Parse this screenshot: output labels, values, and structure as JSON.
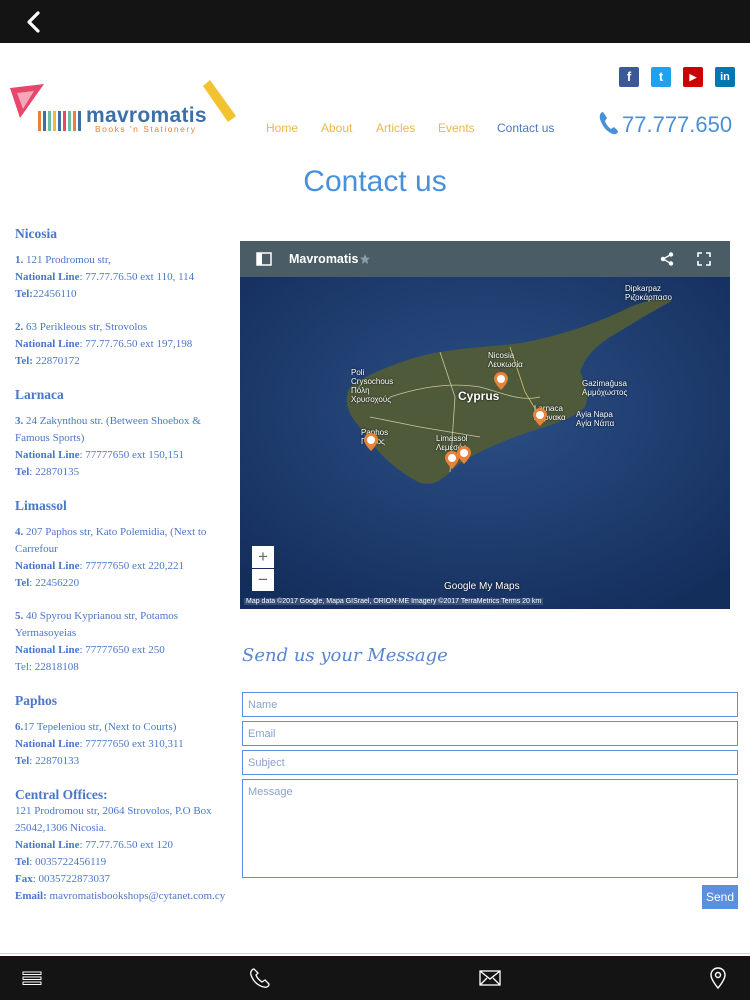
{
  "brand": {
    "name": "mavromatis",
    "tagline": "Books 'n Stationery"
  },
  "nav": [
    {
      "label": "Home"
    },
    {
      "label": "About"
    },
    {
      "label": "Articles"
    },
    {
      "label": "Events"
    },
    {
      "label": "Contact us"
    }
  ],
  "phone": "77.777.650",
  "social": [
    {
      "icon": "facebook-icon",
      "glyph": "f",
      "color": "#3b5998"
    },
    {
      "icon": "twitter-icon",
      "glyph": "t",
      "color": "#1da1f2"
    },
    {
      "icon": "youtube-icon",
      "glyph": "▶",
      "color": "#cc0000"
    },
    {
      "icon": "linkedin-icon",
      "glyph": "in",
      "color": "#0077b5"
    }
  ],
  "page_title": "Contact us",
  "locations": {
    "nicosia": {
      "title": "Nicosia",
      "a1": {
        "num": "1.",
        "line1": " 121 Prodromou str,",
        "nl_label": "National Line",
        "nl_value": ": 77.77.76.50 ext 110, 114",
        "tel_label": "Tel:",
        "tel_value": "22456110"
      },
      "a2": {
        "num": "2.",
        "line1": " 63 Perikleous str, Strovolos",
        "nl_label": "National Line",
        "nl_value": ": 77.77.76.50 ext 197,198",
        "tel_label": "Tel:",
        "tel_value": " 22870172"
      }
    },
    "larnaca": {
      "title": "Larnaca",
      "a3": {
        "num": "3.",
        "line1": " 24 Zakynthou str. (Between Shoebox & Famous Sports)",
        "nl_label": "National Line",
        "nl_value": ": 77777650 ext 150,151",
        "tel_label": "Tel",
        "tel_value": ": 22870135"
      }
    },
    "limassol": {
      "title": "Limassol",
      "a4": {
        "num": "4.",
        "line1": " 207 Paphos str, Kato Polemidia, (Next to Carrefour",
        "nl_label": "National Line",
        "nl_value": ": 77777650 ext 220,221",
        "tel_label": "Tel",
        "tel_value": ": 22456220"
      },
      "a5": {
        "num": "5.",
        "line1": " 40 Spyrou Kyprianou str, Potamos Yermasoyeias",
        "nl_label": "National Line",
        "nl_value": ": 77777650 ext 250",
        "tel_value": "Tel: 22818108"
      }
    },
    "paphos": {
      "title": "Paphos",
      "a6": {
        "num": "6.",
        "line1": "17 Tepeleniou str, (Next to Courts)",
        "nl_label": "National Line",
        "nl_value": ": 77777650 ext 310,311",
        "tel_label": "Tel",
        "tel_value": ": 22870133"
      }
    },
    "central": {
      "title": "Central Offices:",
      "line1": "121 Prodromou str, 2064 Strovolos, P.O Box 25042,1306 Nicosia.",
      "nl_label": "National Line",
      "nl_value": ": 77.77.76.50 ext 120",
      "tel_label": "Tel",
      "tel_value": ": 0035722456119",
      "fax_label": "Fax",
      "fax_value": ": 0035722873037",
      "email_label": "Email:",
      "email_value": " mavromatisbookshops@cytanet.com.cy"
    }
  },
  "map": {
    "title": "Mavromatis",
    "labels": {
      "nicosia": "Nicosia\nΛευκωσία",
      "cyprus": "Cyprus",
      "polis": "Poli\nCrysochous\nΠόλη\nΧρυσοχούς",
      "paphos": "Paphos\nΠάφος",
      "limassol": "Limassol\nΛεμεσός",
      "larnaca": "Larnaca\nΛάρνακα",
      "gazimagusa": "Gazimağusa\nΑμμόχωστος",
      "ayianapa": "Ayia Napa\nΑγία Νάπα",
      "dipkarpaz": "Dipkarpaz\nΡιζοκάρπασο"
    },
    "zoom_in": "+",
    "zoom_out": "−",
    "attribution": "Map data ©2017 Google, Mapa GISrael, ORION-ME Imagery ©2017 TerraMetrics   Terms   20 km",
    "provider": "Google My Maps"
  },
  "form": {
    "title": "Send us your Message",
    "name_placeholder": "Name",
    "email_placeholder": "Email",
    "subject_placeholder": "Subject",
    "message_placeholder": "Message",
    "send_label": "Send"
  }
}
